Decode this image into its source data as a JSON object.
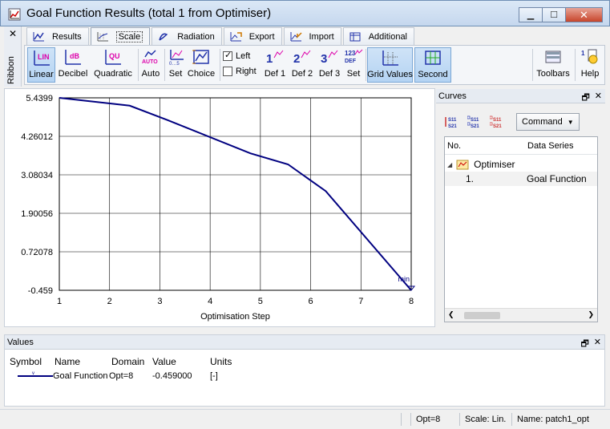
{
  "window": {
    "title": "Goal Function Results (total 1 from Optimiser)",
    "minimize": "▁",
    "maximize": "☐",
    "close": "✕"
  },
  "ribbon": {
    "side_label": "Ribbon",
    "close": "✕",
    "tabs": [
      {
        "label": "Results",
        "icon": "results-icon",
        "active": false
      },
      {
        "label": "Scale",
        "icon": "scale-icon",
        "active": true
      },
      {
        "label": "Radiation",
        "icon": "radiation-icon",
        "active": false
      },
      {
        "label": "Export",
        "icon": "export-icon",
        "active": false
      },
      {
        "label": "Import",
        "icon": "import-icon",
        "active": false
      },
      {
        "label": "Additional",
        "icon": "additional-icon",
        "active": false
      }
    ],
    "tools": {
      "linear": {
        "label": "Linear",
        "glyph": "LIN"
      },
      "decibel": {
        "label": "Decibel",
        "glyph": "dB"
      },
      "quadratic": {
        "label": "Quadratic",
        "glyph": "QU"
      },
      "auto": {
        "label": "Auto",
        "glyph": "AUTO"
      },
      "set": {
        "label": "Set"
      },
      "choice": {
        "label": "Choice"
      },
      "left": {
        "label": "Left",
        "checked": true
      },
      "right": {
        "label": "Right",
        "checked": false
      },
      "def1": {
        "label": "Def 1",
        "glyph": "1"
      },
      "def2": {
        "label": "Def 2",
        "glyph": "2"
      },
      "def3": {
        "label": "Def 3",
        "glyph": "3"
      },
      "set2": {
        "label": "Set",
        "glyph": "1 2 3DEF"
      },
      "grid_values": {
        "label": "Grid Values"
      },
      "second": {
        "label": "Second"
      },
      "toolbars": {
        "label": "Toolbars"
      },
      "help": {
        "label": "Help"
      }
    }
  },
  "chart_data": {
    "type": "line",
    "x": [
      1,
      2.4,
      3.15,
      4.8,
      5.55,
      6.3,
      8
    ],
    "series": [
      {
        "values": [
          5.4399,
          5.2,
          4.76,
          3.74,
          3.4,
          2.58,
          -0.459
        ],
        "color": "#000080"
      }
    ],
    "xlabel": "Optimisation Step",
    "ylabel": "",
    "xticks": [
      1,
      2,
      3,
      4,
      5,
      6,
      7,
      8
    ],
    "yticks": [
      "5.4399",
      "4.26012",
      "3.08034",
      "1.90056",
      "0.72078",
      "-0.459"
    ],
    "ylim": [
      -0.459,
      5.4399
    ],
    "xlim": [
      1,
      8
    ],
    "annotation": "min",
    "grid": true
  },
  "curves": {
    "title": "Curves",
    "command_label": "Command",
    "tool_icons": [
      "s11-s21-icon",
      "s11-s21-compare-icon",
      "s11-s21-diff-icon"
    ],
    "columns": [
      "No.",
      "Data Series"
    ],
    "tree": [
      {
        "label": "Optimiser",
        "expanded": true,
        "children": [
          {
            "no": "1.",
            "series": "Goal Function"
          }
        ]
      }
    ]
  },
  "values": {
    "title": "Values",
    "columns": [
      "Symbol",
      "Name",
      "Domain",
      "Value",
      "Units"
    ],
    "rows": [
      {
        "symbol_color": "#000080",
        "name": "Goal Function",
        "domain": "Opt=8",
        "value": "-0.459000",
        "units": "[-]"
      }
    ]
  },
  "statusbar": {
    "opt": "Opt=8",
    "scale": "Scale: Lin.",
    "name": "Name: patch1_opt"
  }
}
